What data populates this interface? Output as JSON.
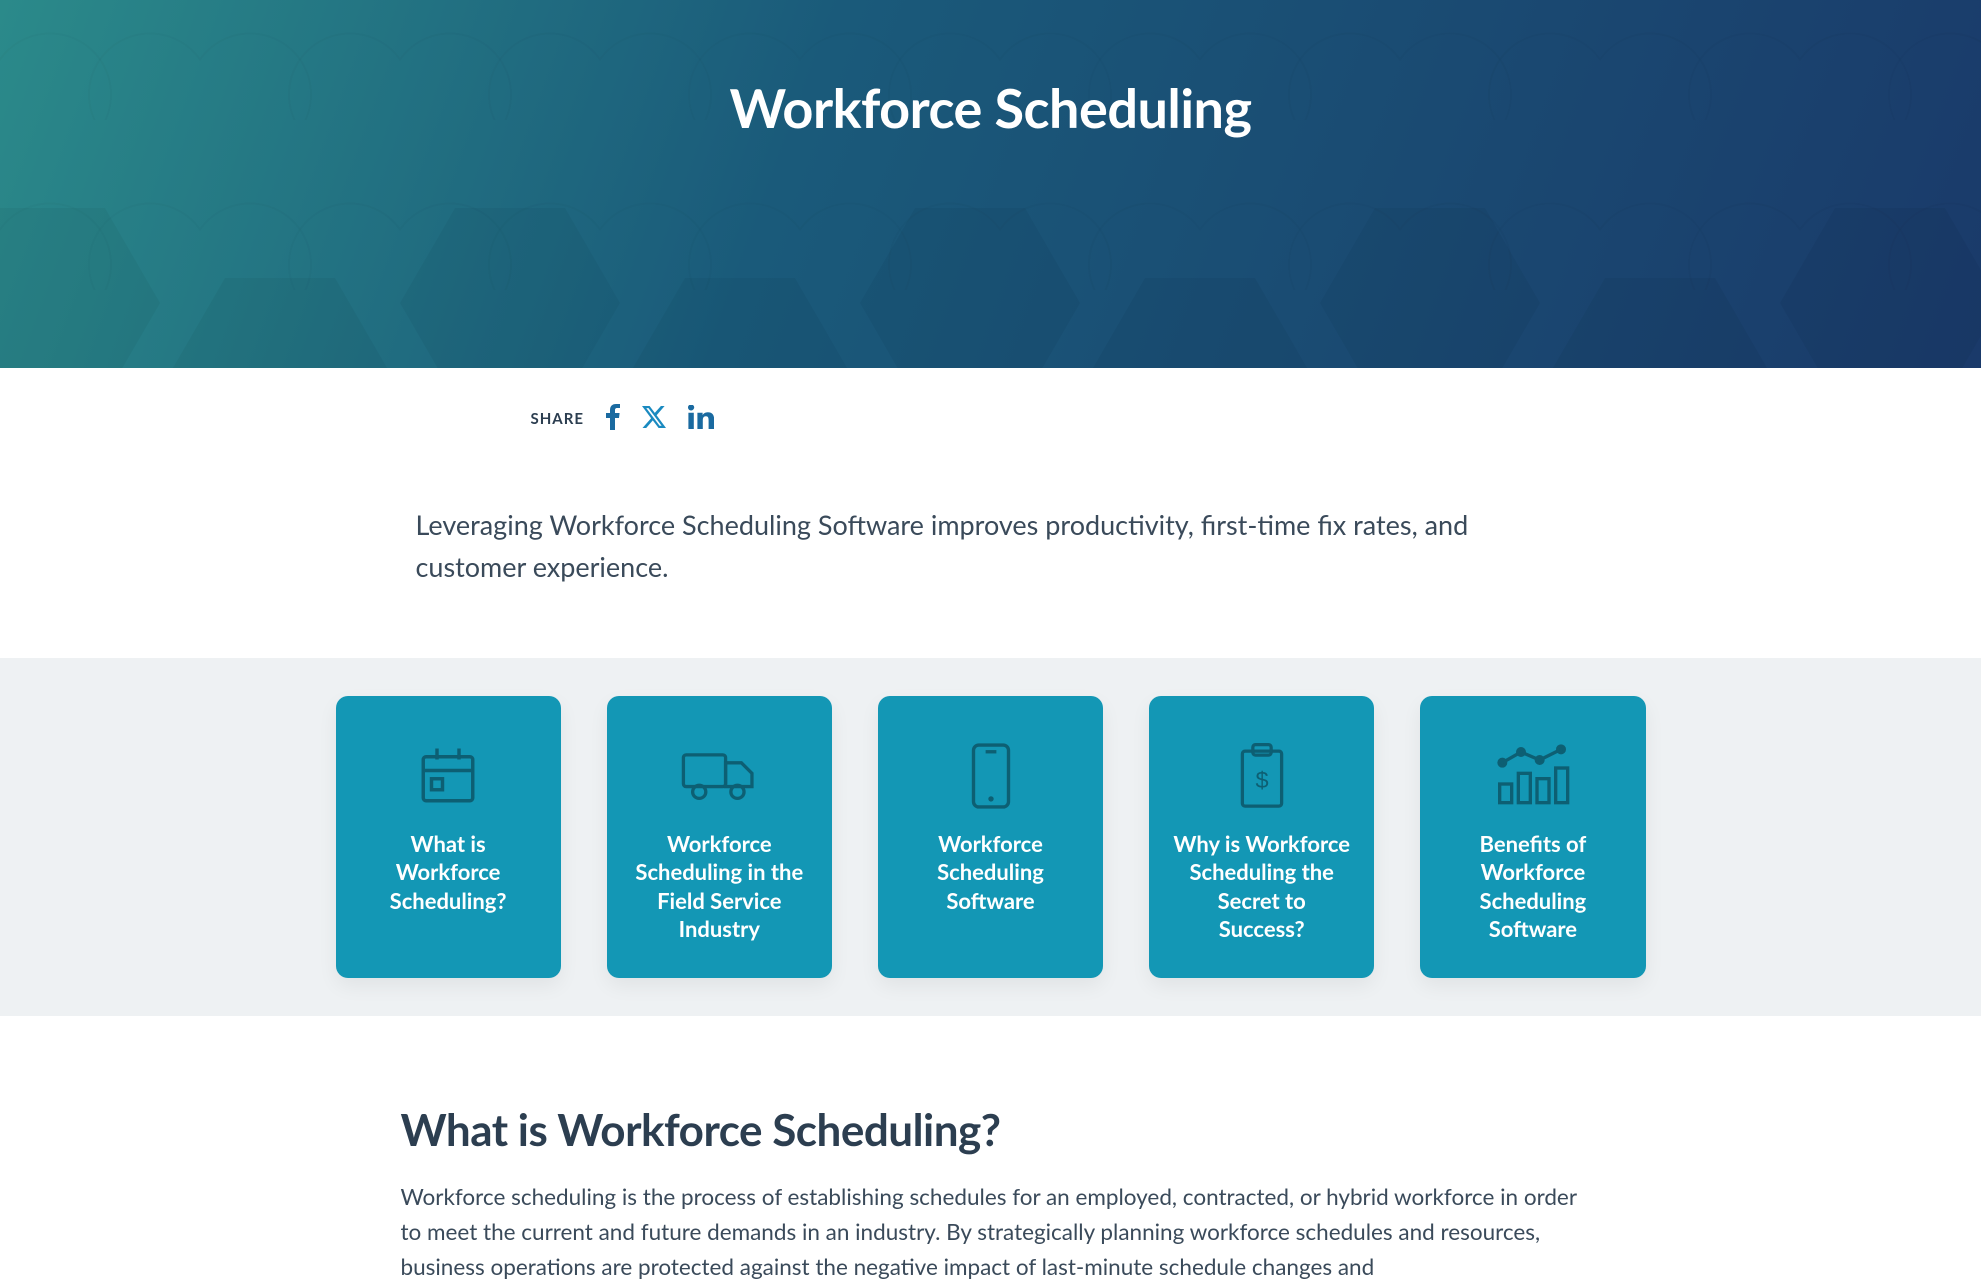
{
  "hero": {
    "title": "Workforce Scheduling"
  },
  "share": {
    "label": "SHARE",
    "icons": {
      "facebook": "facebook-icon",
      "x": "x-icon",
      "linkedin": "linkedin-icon"
    }
  },
  "intro": {
    "text": "Leveraging Workforce Scheduling Software improves productivity, first-time fix rates, and customer experience."
  },
  "cards": [
    {
      "icon": "calendar-icon",
      "title": "What is Workforce Scheduling?"
    },
    {
      "icon": "truck-icon",
      "title": "Workforce Scheduling in the Field Service Industry"
    },
    {
      "icon": "phone-icon",
      "title": "Workforce Scheduling Software"
    },
    {
      "icon": "clipboard-dollar-icon",
      "title": "Why is Workforce Scheduling the Secret to Success?"
    },
    {
      "icon": "chart-icon",
      "title": "Benefits of Workforce Scheduling Software"
    }
  ],
  "article": {
    "heading": "What is Workforce Scheduling?",
    "body": "Workforce scheduling is the process of establishing schedules for an employed, contracted, or hybrid workforce in order to meet the current and future demands in an industry. By strategically planning workforce schedules and resources, business operations are protected against the negative impact of last-minute schedule changes and"
  },
  "colors": {
    "card_bg": "#1397b5",
    "card_icon": "#0d5f73",
    "hero_grad_start": "#2b8a8a",
    "hero_grad_end": "#1a3a6a",
    "cards_section_bg": "#eef1f3",
    "text_dark": "#2c3e50",
    "share_icon": "#1a6aa0"
  }
}
